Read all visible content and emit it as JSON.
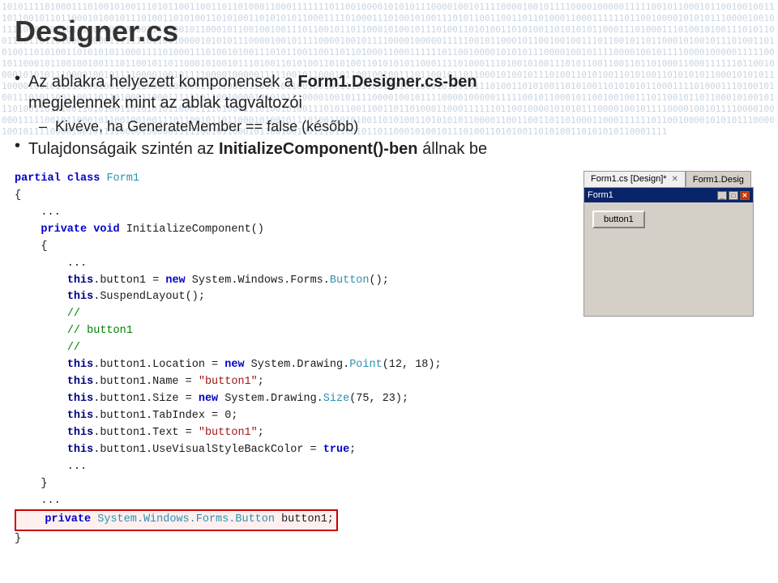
{
  "title": "Designer.cs",
  "binary_text": "1010111101000111010010100111010110011001101101000110001111111011001000010101011100001001011110000100101111000010000011111001011000101100100100111011001011011000101001011101001101010011010100110101010110001111010001110100101001110101100110011011010001100011111101100100001010101110000100101111000010010111100001000001111100101100010110010010011101100101101100010100101110100110101001101010011010101011000111101000111010010100111010110011001101101000110001111110110010000101010111000010010111100001001011110000100000111110010110001011001001001110110010110110001010010111010011010100110101001101010101100011",
  "bullets": [
    {
      "text": "Az ablakra helyezett komponensek a Form1.Designer.cs-ben megjelennek mint az ablak tagváltozói",
      "sub_bullets": [
        "Kivéve, ha GenerateMember == false (később)"
      ]
    },
    {
      "text": "Tulajdonságaik szintén az InitializeComponent()-ben állnak be"
    }
  ],
  "code": {
    "lines": [
      {
        "type": "keyword_class",
        "text": "partial class Form1"
      },
      {
        "type": "plain",
        "text": "{"
      },
      {
        "type": "plain",
        "text": "    ..."
      },
      {
        "type": "method",
        "text": "    private void InitializeComponent()"
      },
      {
        "type": "plain",
        "text": "    {"
      },
      {
        "type": "plain",
        "text": "        ..."
      },
      {
        "type": "this_line",
        "text": "        this.button1 = new System.Windows.Forms.Button();"
      },
      {
        "type": "this_plain",
        "text": "        this.SuspendLayout();"
      },
      {
        "type": "comment",
        "text": "        //"
      },
      {
        "type": "comment",
        "text": "        // button1"
      },
      {
        "type": "comment",
        "text": "        //"
      },
      {
        "type": "this_line",
        "text": "        this.button1.Location = new System.Drawing.Point(12, 18);"
      },
      {
        "type": "this_plain",
        "text": "        this.button1.Name = \"button1\";"
      },
      {
        "type": "this_plain",
        "text": "        this.button1.Size = new System.Drawing.Size(75, 23);"
      },
      {
        "type": "this_plain",
        "text": "        this.button1.TabIndex = 0;"
      },
      {
        "type": "this_plain",
        "text": "        this.button1.Text = \"button1\";"
      },
      {
        "type": "this_plain",
        "text": "        this.button1.UseVisualStyleBackColor = true;"
      },
      {
        "type": "plain",
        "text": "        ..."
      },
      {
        "type": "plain",
        "text": "    }"
      },
      {
        "type": "plain",
        "text": "    ..."
      },
      {
        "type": "highlighted",
        "text": "    private System.Windows.Forms.Button button1;"
      },
      {
        "type": "plain",
        "text": "}"
      }
    ]
  },
  "vs_panel": {
    "tab1_label": "Form1.cs [Design]*",
    "tab2_label": "Form1.Desig",
    "form_title": "Form1",
    "button_label": "button1"
  },
  "icons": {
    "bullet": "•",
    "dash": "–",
    "minimize": "_",
    "maximize": "□",
    "close": "✕"
  }
}
